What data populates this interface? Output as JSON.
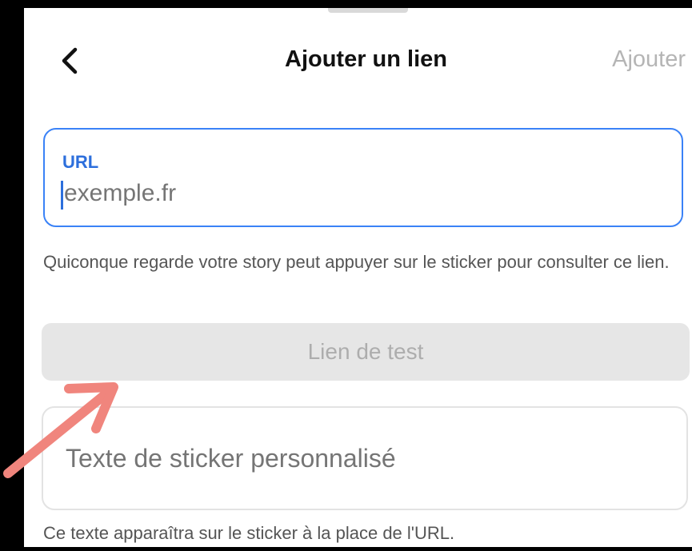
{
  "header": {
    "title": "Ajouter un lien",
    "add_label": "Ajouter"
  },
  "url_field": {
    "label": "URL",
    "placeholder": "exemple.fr",
    "value": ""
  },
  "helper_text": "Quiconque regarde votre story peut appuyer sur le sticker pour consulter ce lien.",
  "test_button": {
    "label": "Lien de test"
  },
  "sticker_field": {
    "placeholder": "Texte de sticker personnalisé",
    "value": ""
  },
  "sticker_helper": "Ce texte apparaîtra sur le sticker à la place de l'URL.",
  "icons": {
    "back": "chevron-left-icon",
    "annotation": "arrow-annotation-icon"
  },
  "colors": {
    "accent": "#3a82f7",
    "label_blue": "#2d6fdc",
    "disabled_text": "#b5b5b5",
    "arrow": "#f0857d"
  }
}
